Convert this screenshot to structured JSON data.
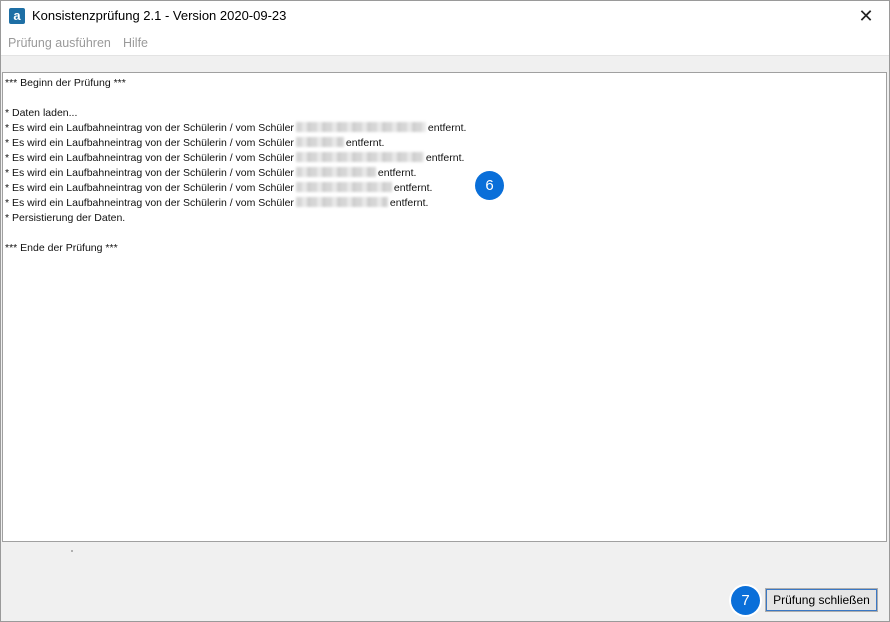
{
  "window": {
    "title": "Konsistenzprüfung 2.1 - Version 2020-09-23",
    "icon_letter": "a",
    "close_glyph": "✕"
  },
  "menu": {
    "items": [
      "Prüfung ausführen",
      "Hilfe"
    ]
  },
  "log": {
    "begin": "*** Beginn der Prüfung ***",
    "loading": " * Daten laden...",
    "entry_prefix": " * Es wird ein Laufbahneintrag von der Schülerin / vom Schüler",
    "entry_suffix": "entfernt.",
    "persist": " * Persistierung der Daten.",
    "end": "*** Ende der Prüfung ***"
  },
  "annotations": {
    "badge_log": "6",
    "badge_button": "7"
  },
  "buttons": {
    "close_check": "Prüfung schließen"
  },
  "colors": {
    "badge": "#0a6fd9",
    "app_icon": "#1e6fa5"
  }
}
